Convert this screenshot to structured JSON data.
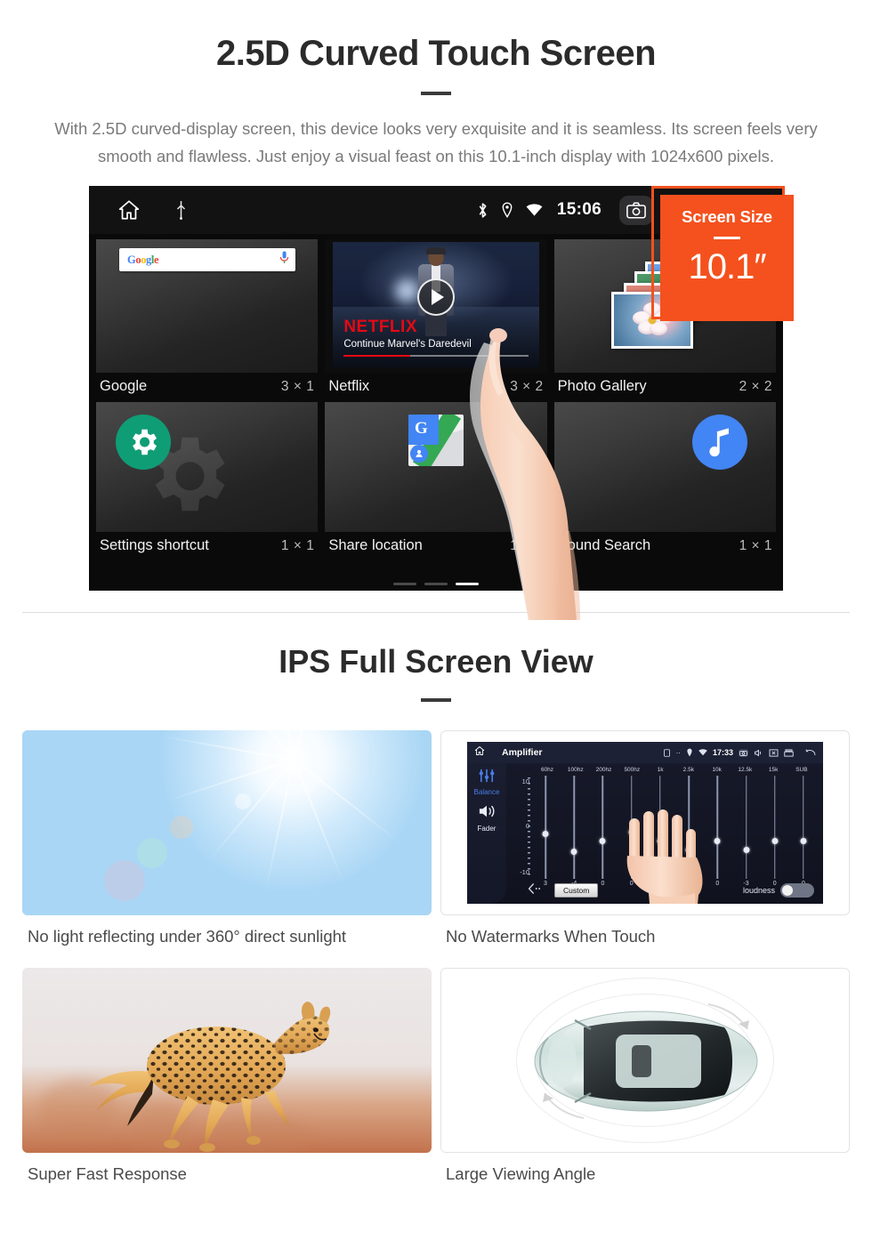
{
  "section1": {
    "title": "2.5D Curved Touch Screen",
    "description": "With 2.5D curved-display screen, this device looks very exquisite and it is seamless. Its screen feels very smooth and flawless. Just enjoy a visual feast on this 10.1-inch display with 1024x600 pixels.",
    "badge": {
      "title": "Screen Size",
      "value": "10.1″",
      "color": "#f4511e"
    }
  },
  "device": {
    "statusbar": {
      "home_icon": "home-icon",
      "usb_icon": "usb-icon",
      "bluetooth_icon": "bluetooth-icon",
      "location_icon": "location-icon",
      "wifi_icon": "wifi-icon",
      "time": "15:06",
      "camera_icon": "camera-icon",
      "volume_icon": "volume-icon",
      "close_icon": "close-box-icon",
      "recents_icon": "recent-apps-icon"
    },
    "widgets": [
      {
        "name": "Google",
        "size": "3 × 1",
        "search_placeholder": "",
        "logo": "Google",
        "mic_icon": "microphone-icon"
      },
      {
        "name": "Netflix",
        "size": "3 × 2",
        "brand": "NETFLIX",
        "subtitle": "Continue Marvel's Daredevil",
        "play_icon": "play-icon"
      },
      {
        "name": "Photo Gallery",
        "size": "2 × 2",
        "icon": "photo-stack-icon"
      },
      {
        "name": "Settings shortcut",
        "size": "1 × 1",
        "icon": "gear-icon"
      },
      {
        "name": "Share location",
        "size": "1 × 1",
        "icon": "google-maps-icon"
      },
      {
        "name": "Sound Search",
        "size": "1 × 1",
        "icon": "music-note-icon"
      }
    ],
    "page_dots": {
      "count": 3,
      "active_index": 2
    }
  },
  "section2": {
    "title": "IPS Full Screen View",
    "cards": [
      {
        "caption": "No light reflecting under 360° direct sunlight",
        "media": "sunlight-photo"
      },
      {
        "caption": "No Watermarks When Touch",
        "media": "amplifier-screenshot"
      },
      {
        "caption": "Super Fast Response",
        "media": "cheetah-photo"
      },
      {
        "caption": "Large Viewing Angle",
        "media": "car-top-view"
      }
    ]
  },
  "amplifier": {
    "title": "Amplifier",
    "time": "17:33",
    "home_icon": "home-icon",
    "sidebar": [
      {
        "label": "Balance",
        "icon": "equalizer-icon",
        "active": true
      },
      {
        "label": "Fader",
        "icon": "speaker-icon",
        "active": false
      }
    ],
    "scale": [
      "10",
      "0",
      "-10"
    ],
    "bands": [
      "60hz",
      "100hz",
      "200hz",
      "500hz",
      "1k",
      "2.5k",
      "10k",
      "12.5k",
      "15k",
      "SUB"
    ],
    "values": [
      "3",
      "-4",
      "0",
      "0",
      "0",
      "-3",
      "0",
      "-3",
      "0",
      "0"
    ],
    "preset_button": "Custom",
    "back_icon": "back-arrow-icon",
    "loudness_label": "loudness",
    "loudness_on": false
  }
}
